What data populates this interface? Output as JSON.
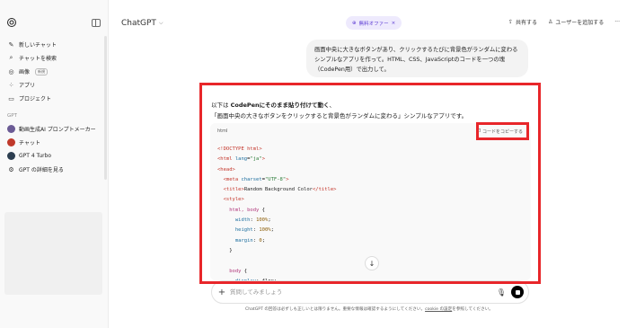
{
  "sidebar": {
    "items": [
      {
        "icon": "edit-icon",
        "label": "新しいチャット"
      },
      {
        "icon": "search-icon",
        "label": "チャットを検索"
      },
      {
        "icon": "image-icon",
        "label": "画像",
        "badge": "新規"
      },
      {
        "icon": "apps-icon",
        "label": "アプリ"
      },
      {
        "icon": "folder-icon",
        "label": "プロジェクト"
      }
    ],
    "gpt_section_label": "GPT",
    "gpts": [
      {
        "icon": "gpt-avatar-image-generator",
        "label": "動画生成AI プロンプトメーカー",
        "color": "#6b5b95"
      },
      {
        "icon": "gpt-avatar-chat",
        "label": "チャット",
        "color": "#c0392b"
      },
      {
        "icon": "gpt-avatar-gpt4-turbo",
        "label": "GPT 4 Turbo",
        "color": "#2c3e50"
      },
      {
        "icon": "explore-gpt-icon",
        "label": "GPT の詳細を見る"
      }
    ]
  },
  "header": {
    "title": "ChatGPT",
    "offer": "無料オファー",
    "share_label": "共有する",
    "add_user_label": "ユーザーを追加する",
    "more_label": "···"
  },
  "conversation": {
    "user_message": "画面中央に大きなボタンがあり、クリックするたびに背景色がランダムに変わるシンプルなアプリを作って。HTML、CSS、JavaScriptのコードを一つの塊（CodePen用）で出力して。",
    "answer_line1_prefix": "以下は ",
    "answer_line1_bold": "CodePenにそのまま貼り付けて動く",
    "answer_line1_suffix": "、",
    "answer_line2": "「画面中央の大きなボタンをクリックすると背景色がランダムに変わる」シンプルなアプリです。",
    "code_lang": "html",
    "copy_label": "コードをコピーする"
  },
  "composer": {
    "placeholder": "質問してみましょう",
    "disclaimer_prefix": "ChatGPT の回答は必ずしも正しいとは限りません。重要な情報は確認するようにしてください。",
    "disclaimer_link": "cookie の設定",
    "disclaimer_suffix": "を参照してください。"
  },
  "colors": {
    "annotation_red": "#e8262a",
    "offer_purple": "#5b3ad3"
  }
}
